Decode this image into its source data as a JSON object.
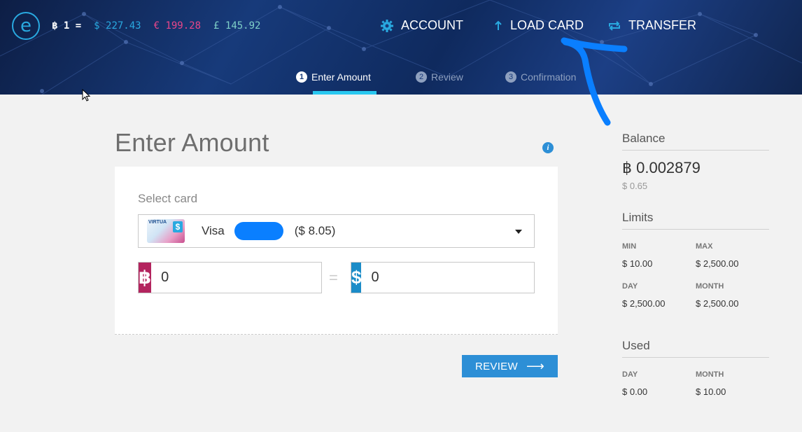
{
  "header": {
    "logo_glyph": "e",
    "rates": {
      "btc": "฿ 1 =",
      "usd": "$ 227.43",
      "eur": "€ 199.28",
      "gbp": "£ 145.92"
    },
    "nav": {
      "account": "ACCOUNT",
      "load_card": "LOAD CARD",
      "transfer": "TRANSFER"
    },
    "steps": [
      {
        "num": "1",
        "label": "Enter Amount"
      },
      {
        "num": "2",
        "label": "Review"
      },
      {
        "num": "3",
        "label": "Confirmation"
      }
    ]
  },
  "main": {
    "title": "Enter Amount",
    "info_glyph": "i",
    "select_label": "Select card",
    "card": {
      "brand_text": "VIRTUA",
      "thumb_glyph": "$",
      "name": "Visa",
      "amount": "($ 8.05)"
    },
    "btc_symbol": "฿",
    "btc_value": "0",
    "equals": "=",
    "usd_symbol": "$",
    "usd_value": "0",
    "review_label": "REVIEW",
    "review_arrow": "⟶"
  },
  "sidebar": {
    "balance_title": "Balance",
    "balance_btc": "฿ 0.002879",
    "balance_usd": "$ 0.65",
    "limits_title": "Limits",
    "limits": {
      "min_label": "MIN",
      "min_value": "$ 10.00",
      "max_label": "MAX",
      "max_value": "$ 2,500.00",
      "day_label": "DAY",
      "day_value": "$ 2,500.00",
      "month_label": "MONTH",
      "month_value": "$ 2,500.00"
    },
    "used_title": "Used",
    "used": {
      "day_label": "DAY",
      "day_value": "$ 0.00",
      "month_label": "MONTH",
      "month_value": "$ 10.00"
    }
  },
  "colors": {
    "accent": "#2d8fd6",
    "btc_badge": "#b3245e",
    "usd_badge": "#1b8cc8",
    "annotation": "#0a7fff",
    "step_active": "#29c8f0"
  }
}
